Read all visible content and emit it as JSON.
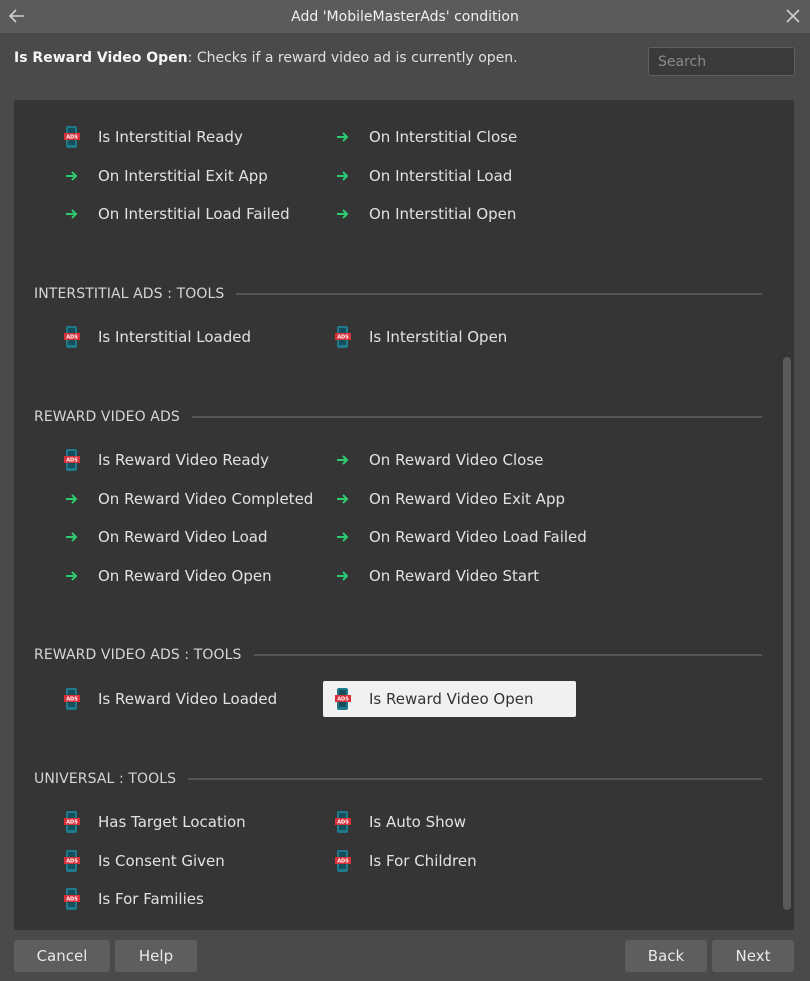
{
  "window": {
    "title": "Add 'MobileMasterAds' condition",
    "back_icon": "arrow-left-icon",
    "close_icon": "close-icon"
  },
  "description": {
    "name": "Is Reward Video Open",
    "text": ": Checks if a reward video ad is currently open."
  },
  "search": {
    "placeholder": "Search",
    "value": ""
  },
  "sections": {
    "top": {
      "items": [
        {
          "label": "Is Interstitial Ready",
          "icon": "ads-phone-icon"
        },
        {
          "label": "On Interstitial Close",
          "icon": "green-arrow-icon"
        },
        {
          "label": "On Interstitial Exit App",
          "icon": "green-arrow-icon"
        },
        {
          "label": "On Interstitial Load",
          "icon": "green-arrow-icon"
        },
        {
          "label": "On Interstitial Load Failed",
          "icon": "green-arrow-icon"
        },
        {
          "label": "On Interstitial Open",
          "icon": "green-arrow-icon"
        }
      ]
    },
    "interstitial_tools": {
      "title": "INTERSTITIAL ADS : TOOLS",
      "items": [
        {
          "label": "Is Interstitial Loaded",
          "icon": "ads-phone-icon"
        },
        {
          "label": "Is Interstitial Open",
          "icon": "ads-phone-icon"
        }
      ]
    },
    "reward": {
      "title": "REWARD VIDEO ADS",
      "items": [
        {
          "label": "Is Reward Video Ready",
          "icon": "ads-phone-icon"
        },
        {
          "label": "On Reward Video Close",
          "icon": "green-arrow-icon"
        },
        {
          "label": "On Reward Video Completed",
          "icon": "green-arrow-icon"
        },
        {
          "label": "On Reward Video Exit App",
          "icon": "green-arrow-icon"
        },
        {
          "label": "On Reward Video Load",
          "icon": "green-arrow-icon"
        },
        {
          "label": "On Reward Video Load Failed",
          "icon": "green-arrow-icon"
        },
        {
          "label": "On Reward Video Open",
          "icon": "green-arrow-icon"
        },
        {
          "label": "On Reward Video Start",
          "icon": "green-arrow-icon"
        }
      ]
    },
    "reward_tools": {
      "title": "REWARD VIDEO ADS : TOOLS",
      "items": [
        {
          "label": "Is Reward Video Loaded",
          "icon": "ads-phone-icon"
        },
        {
          "label": "Is Reward Video Open",
          "icon": "ads-phone-icon",
          "selected": true
        }
      ]
    },
    "universal_tools": {
      "title": "UNIVERSAL : TOOLS",
      "items": [
        {
          "label": "Has Target Location",
          "icon": "ads-phone-icon"
        },
        {
          "label": "Is Auto Show",
          "icon": "ads-phone-icon"
        },
        {
          "label": "Is Consent Given",
          "icon": "ads-phone-icon"
        },
        {
          "label": "Is For Children",
          "icon": "ads-phone-icon"
        },
        {
          "label": "Is For Families",
          "icon": "ads-phone-icon"
        }
      ]
    }
  },
  "footer": {
    "cancel": "Cancel",
    "help": "Help",
    "back": "Back",
    "next": "Next"
  },
  "colors": {
    "background": "#4a4a4a",
    "panel": "#353535",
    "selected": "#f1f1f1",
    "arrow_green": "#2ecc71",
    "icon_teal": "#1f7a8c",
    "icon_red": "#d8313a"
  }
}
